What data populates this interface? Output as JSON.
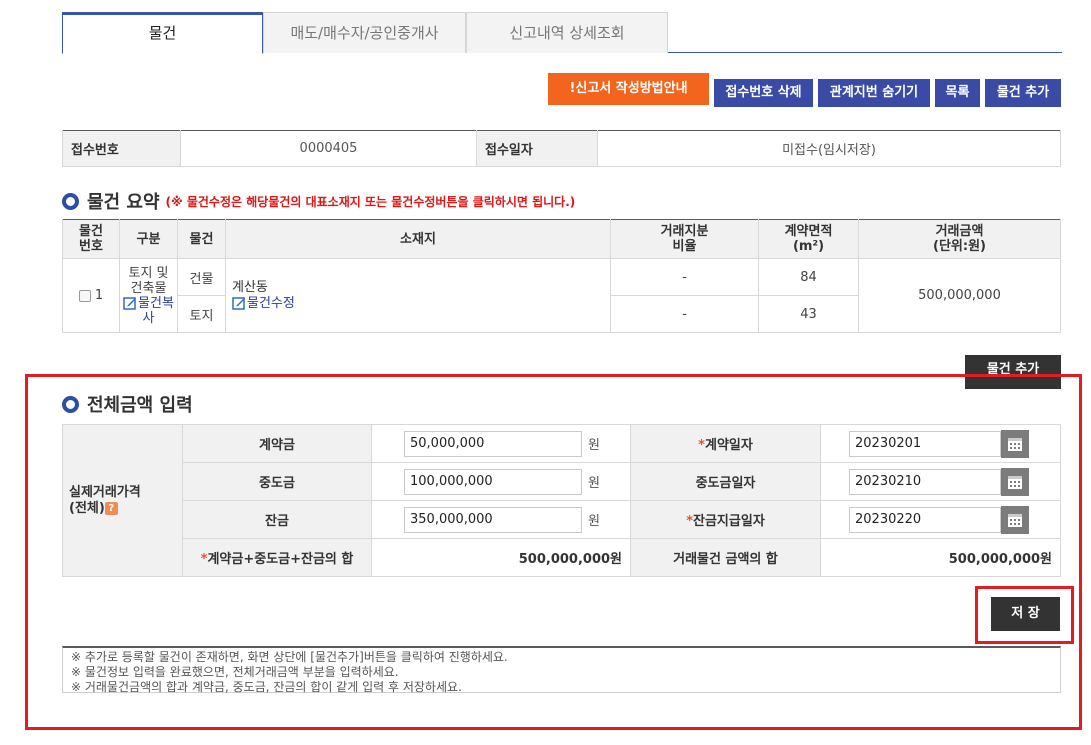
{
  "tabs": [
    "물건",
    "매도/매수자/공인중개사",
    "신고내역 상세조회"
  ],
  "actions": {
    "guide": "!신고서 작성방법안내",
    "delete_receipt": "접수번호 삭제",
    "hide_lot": "관계지번 숨기기",
    "list": "목록",
    "add_item": "물건 추가"
  },
  "info": {
    "receipt_no_label": "접수번호",
    "receipt_no": "0000405",
    "receipt_date_label": "접수일자",
    "receipt_date": "미접수(임시저장)"
  },
  "summary": {
    "title": "물건 요약",
    "notice": "(※ 물건수정은 해당물건의 대표소재지 또는 물건수정버튼을 클릭하시면 됩니다.)",
    "headers": {
      "no": [
        "물건",
        "번호"
      ],
      "category": "구분",
      "item": "물건",
      "location": "소재지",
      "share": [
        "거래지분",
        "비율"
      ],
      "area": "계약면적",
      "area_unit": "(m²)",
      "price": [
        "거래금액",
        "(단위:원)"
      ]
    },
    "row": {
      "no": "1",
      "category": "토지 및 건축물",
      "copy_link": "물건복사",
      "items": [
        "건물",
        "토지"
      ],
      "location": "계산동",
      "edit_link": "물건수정",
      "shares": [
        "-",
        "-"
      ],
      "areas": [
        "84",
        "43"
      ],
      "price": "500,000,000"
    },
    "add_button": "물건 추가"
  },
  "amount": {
    "title": "전체금액 입력",
    "side_label": "실제거래가격",
    "side_label2": "(전체)",
    "help": "?",
    "down_payment_label": "계약금",
    "down_payment": "50,000,000",
    "middle_payment_label": "중도금",
    "middle_payment": "100,000,000",
    "balance_label": "잔금",
    "balance": "350,000,000",
    "won": "원",
    "contract_date_label": "계약일자",
    "contract_date": "20230201",
    "middle_date_label": "중도금일자",
    "middle_date": "20230210",
    "balance_date_label": "잔금지급일자",
    "balance_date": "20230220",
    "sum_label": "계약금+중도금+잔금의 합",
    "sum_value": "500,000,000원",
    "trade_sum_label": "거래물건 금액의 합",
    "trade_sum_value": "500,000,000원",
    "save": "저 장"
  },
  "notes": [
    "※ 추가로 등록할 물건이 존재하면, 화면 상단에 [물건추가]버튼을 클릭하여 진행하세요.",
    "※ 물건정보 입력을 완료했으면, 전체거래금액 부분을 입력하세요.",
    "※ 거래물건금액의 합과 계약금, 중도금, 잔금의 합이 같게 입력 후 저장하세요."
  ],
  "colors": {
    "accent": "#3a4ba6",
    "orange": "#f3641f",
    "highlight": "#e31b23"
  }
}
